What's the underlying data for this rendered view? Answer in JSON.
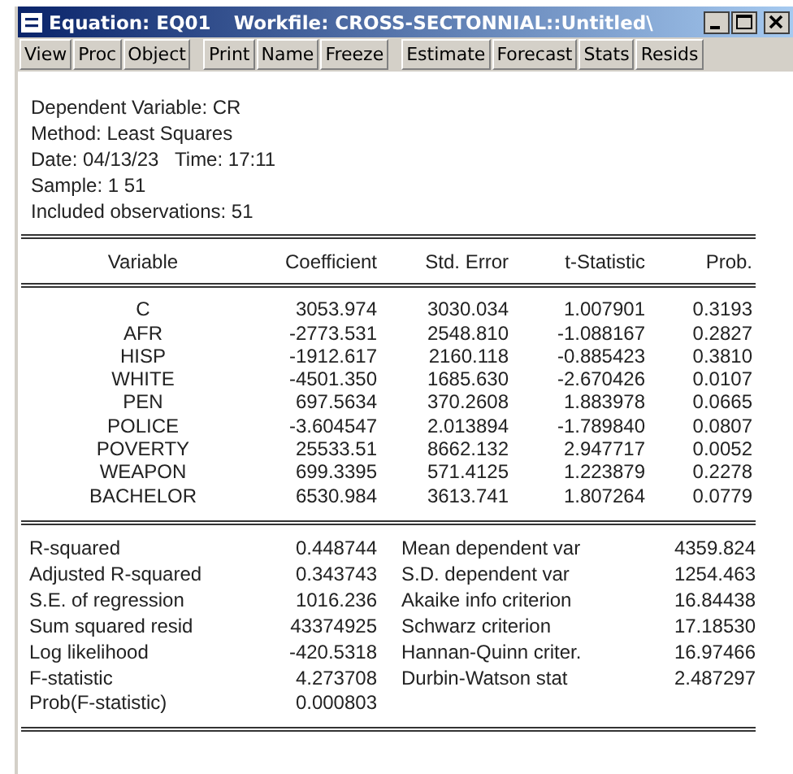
{
  "window": {
    "title_parts": [
      "Equation: EQ01",
      "Workfile: CROSS-SECTONNIAL::Untitled\\"
    ]
  },
  "toolbar": [
    [
      "View",
      "Proc",
      "Object"
    ],
    [
      "Print",
      "Name",
      "Freeze"
    ],
    [
      "Estimate",
      "Forecast",
      "Stats",
      "Resids"
    ]
  ],
  "header_lines": [
    "Dependent Variable: CR",
    "Method: Least Squares",
    "Date: 04/13/23   Time: 17:11",
    "Sample: 1 51",
    "Included observations: 51"
  ],
  "coefficients": {
    "columns": [
      "Variable",
      "Coefficient",
      "Std. Error",
      "t-Statistic",
      "Prob."
    ],
    "rows": [
      [
        "C",
        "3053.974",
        "3030.034",
        "1.007901",
        "0.3193"
      ],
      [
        "AFR",
        "-2773.531",
        "2548.810",
        "-1.088167",
        "0.2827"
      ],
      [
        "HISP",
        "-1912.617",
        "2160.118",
        "-0.885423",
        "0.3810"
      ],
      [
        "WHITE",
        "-4501.350",
        "1685.630",
        "-2.670426",
        "0.0107"
      ],
      [
        "PEN",
        "697.5634",
        "370.2608",
        "1.883978",
        "0.0665"
      ],
      [
        "POLICE",
        "-3.604547",
        "2.013894",
        "-1.789840",
        "0.0807"
      ],
      [
        "POVERTY",
        "25533.51",
        "8662.132",
        "2.947717",
        "0.0052"
      ],
      [
        "WEAPON",
        "699.3395",
        "571.4125",
        "1.223879",
        "0.2278"
      ],
      [
        "BACHELOR",
        "6530.984",
        "3613.741",
        "1.807264",
        "0.0779"
      ]
    ]
  },
  "statistics": [
    [
      "R-squared",
      "0.448744",
      "Mean dependent var",
      "4359.824"
    ],
    [
      "Adjusted R-squared",
      "0.343743",
      "S.D. dependent var",
      "1254.463"
    ],
    [
      "S.E. of regression",
      "1016.236",
      "Akaike info criterion",
      "16.84438"
    ],
    [
      "Sum squared resid",
      "43374925",
      "Schwarz criterion",
      "17.18530"
    ],
    [
      "Log likelihood",
      "-420.5318",
      "Hannan-Quinn criter.",
      "16.97466"
    ],
    [
      "F-statistic",
      "4.273708",
      "Durbin-Watson stat",
      "2.487297"
    ],
    [
      "Prob(F-statistic)",
      "0.000803"
    ]
  ]
}
